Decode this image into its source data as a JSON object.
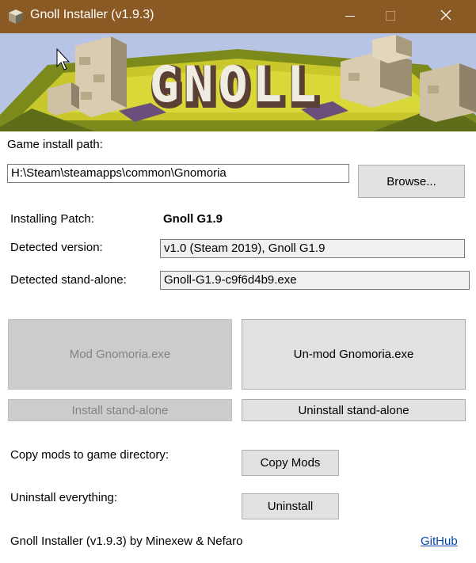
{
  "window": {
    "title": "Gnoll Installer (v1.9.3)",
    "titlebar_color": "#8b5a24",
    "icons": [
      "app-cube-icon",
      "minimize-icon",
      "maximize-icon",
      "close-icon"
    ]
  },
  "banner": {
    "logo_text": "GNOLL"
  },
  "install_path": {
    "label": "Game install path:",
    "value": "H:\\Steam\\steamapps\\common\\Gnomoria",
    "browse_label": "Browse..."
  },
  "patch": {
    "label": "Installing Patch:",
    "value": "Gnoll G1.9"
  },
  "detected_version": {
    "label": "Detected version:",
    "value": "v1.0 (Steam 2019), Gnoll G1.9"
  },
  "detected_standalone": {
    "label": "Detected stand-alone:",
    "value": "Gnoll-G1.9-c9f6d4b9.exe"
  },
  "actions": {
    "mod_label": "Mod Gnomoria.exe",
    "unmod_label": "Un-mod Gnomoria.exe",
    "install_standalone_label": "Install stand-alone",
    "uninstall_standalone_label": "Uninstall stand-alone"
  },
  "copy_mods": {
    "label": "Copy mods to game directory:",
    "button_label": "Copy Mods"
  },
  "uninstall_all": {
    "label": "Uninstall everything:",
    "button_label": "Uninstall"
  },
  "footer": {
    "credits": "Gnoll Installer (v1.9.3) by Minexew & Nefaro",
    "github_label": "GitHub"
  }
}
